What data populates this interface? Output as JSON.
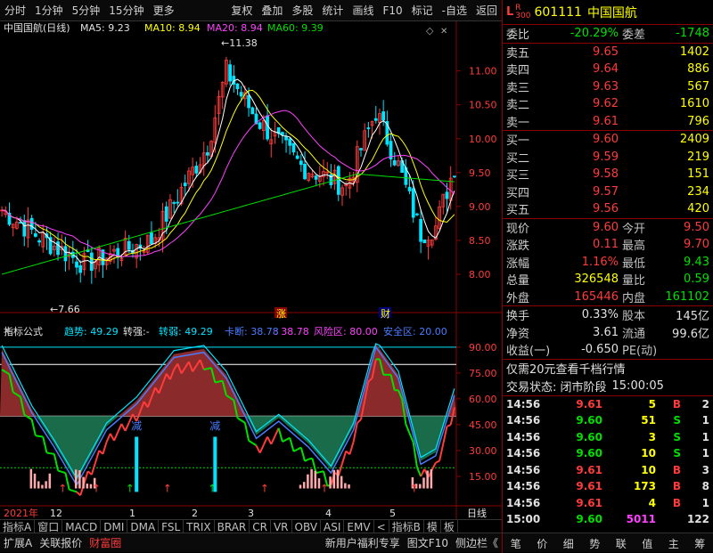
{
  "toolbar": {
    "left": [
      "分时",
      "1分钟",
      "5分钟",
      "15分钟",
      "更多"
    ],
    "right": [
      "复权",
      "叠加",
      "多股",
      "统计",
      "画线",
      "F10",
      "标记",
      "-自选",
      "返回"
    ]
  },
  "main_chart": {
    "title": "中国国航(日线)",
    "ma5_label": "MA5: 9.23",
    "ma10_label": "MA10: 8.94",
    "ma20_label": "MA20: 8.94",
    "ma60_label": "MA60: 9.39",
    "high_mark": "11.38",
    "low_mark": "7.66",
    "event_zhang": "涨",
    "event_cai": "财",
    "y_ticks": [
      "11.00",
      "10.50",
      "10.00",
      "9.50",
      "9.00",
      "8.50",
      "8.00"
    ]
  },
  "indicator": {
    "name": "指标公式",
    "trend": "趋势: 49.29",
    "zhuanqiang": "转强:-",
    "zhuanruo": "转弱: 49.29",
    "kaduan": "卡断: 38.78",
    "kaduan2": ": 38.78",
    "risk": "风险区: 80.00",
    "safe": "安全区: 20.00",
    "y_ticks": [
      "90.00",
      "75.00",
      "60.00",
      "45.00",
      "30.00",
      "15.00"
    ],
    "labels": [
      "减",
      "减"
    ]
  },
  "x_axis": {
    "labels": [
      "2021年",
      "12",
      "1",
      "2",
      "3",
      "4",
      "5"
    ],
    "period": "日线"
  },
  "tabs": [
    "指标A",
    "窗口",
    "MACD",
    "DMI",
    "DMA",
    "FSL",
    "TRIX",
    "BRAR",
    "CR",
    "VR",
    "OBV",
    "ASI",
    "EMV",
    "<",
    "指标B",
    "模",
    "板"
  ],
  "bottom": {
    "items": [
      "扩展A",
      "关联报价",
      "财富圈"
    ],
    "right_items": [
      "新用户福利专享",
      "图文F10",
      "侧边栏《"
    ]
  },
  "quote": {
    "code": "601111",
    "name": "中国国航",
    "badge_l": "L",
    "badge_r": "R",
    "badge_num": "300",
    "webi_label": "委比",
    "webi": "-20.29%",
    "weicha_label": "委差",
    "weicha": "-1748",
    "sells": [
      {
        "label": "卖五",
        "price": "9.65",
        "vol": "1402"
      },
      {
        "label": "卖四",
        "price": "9.64",
        "vol": "886"
      },
      {
        "label": "卖三",
        "price": "9.63",
        "vol": "567"
      },
      {
        "label": "卖二",
        "price": "9.62",
        "vol": "1610"
      },
      {
        "label": "卖一",
        "price": "9.61",
        "vol": "796"
      }
    ],
    "buys": [
      {
        "label": "买一",
        "price": "9.60",
        "vol": "2409"
      },
      {
        "label": "买二",
        "price": "9.59",
        "vol": "219"
      },
      {
        "label": "买三",
        "price": "9.58",
        "vol": "151"
      },
      {
        "label": "买四",
        "price": "9.57",
        "vol": "234"
      },
      {
        "label": "买五",
        "price": "9.56",
        "vol": "420"
      }
    ],
    "stats": [
      {
        "l1": "现价",
        "v1": "9.60",
        "c1": "red",
        "l2": "今开",
        "v2": "9.50",
        "c2": "red"
      },
      {
        "l1": "涨跌",
        "v1": "0.11",
        "c1": "red",
        "l2": "最高",
        "v2": "9.70",
        "c2": "red"
      },
      {
        "l1": "涨幅",
        "v1": "1.16%",
        "c1": "red",
        "l2": "最低",
        "v2": "9.43",
        "c2": "grn"
      },
      {
        "l1": "总量",
        "v1": "326548",
        "c1": "yel",
        "l2": "量比",
        "v2": "0.59",
        "c2": "grn"
      },
      {
        "l1": "外盘",
        "v1": "165446",
        "c1": "red",
        "l2": "内盘",
        "v2": "161102",
        "c2": "grn"
      }
    ],
    "stats2": [
      {
        "l1": "换手",
        "v1": "0.33%",
        "l2": "股本",
        "v2": "145亿"
      },
      {
        "l1": "净资",
        "v1": "3.61",
        "l2": "流通",
        "v2": "99.6亿"
      },
      {
        "l1": "收益(一)",
        "v1": "-0.650",
        "l2": "PE(动)",
        "v2": ""
      }
    ],
    "promo": "仅需20元查看千档行情",
    "status_label": "交易状态: 闭市阶段",
    "status_time": "15:00:05",
    "ticks": [
      {
        "t": "14:56",
        "p": "9.61",
        "v": "5",
        "s": "B",
        "n": "2"
      },
      {
        "t": "14:56",
        "p": "9.60",
        "v": "51",
        "s": "S",
        "n": "1"
      },
      {
        "t": "14:56",
        "p": "9.60",
        "v": "3",
        "s": "S",
        "n": "1"
      },
      {
        "t": "14:56",
        "p": "9.60",
        "v": "10",
        "s": "S",
        "n": "1"
      },
      {
        "t": "14:56",
        "p": "9.61",
        "v": "10",
        "s": "B",
        "n": "3"
      },
      {
        "t": "14:56",
        "p": "9.61",
        "v": "173",
        "s": "B",
        "n": "8"
      },
      {
        "t": "14:56",
        "p": "9.61",
        "v": "4",
        "s": "B",
        "n": "1"
      },
      {
        "t": "15:00",
        "p": "9.60",
        "v": "5011",
        "s": "",
        "n": "122"
      }
    ],
    "bottom_btns": [
      "笔",
      "价",
      "细",
      "势",
      "联",
      "值",
      "主",
      "筹"
    ]
  },
  "colors": {
    "up": "#ff3b3b",
    "down": "#00e5ff",
    "ma5": "#ffffff",
    "ma10": "#ffff00",
    "ma20": "#ff40ff",
    "ma60": "#00e000"
  }
}
